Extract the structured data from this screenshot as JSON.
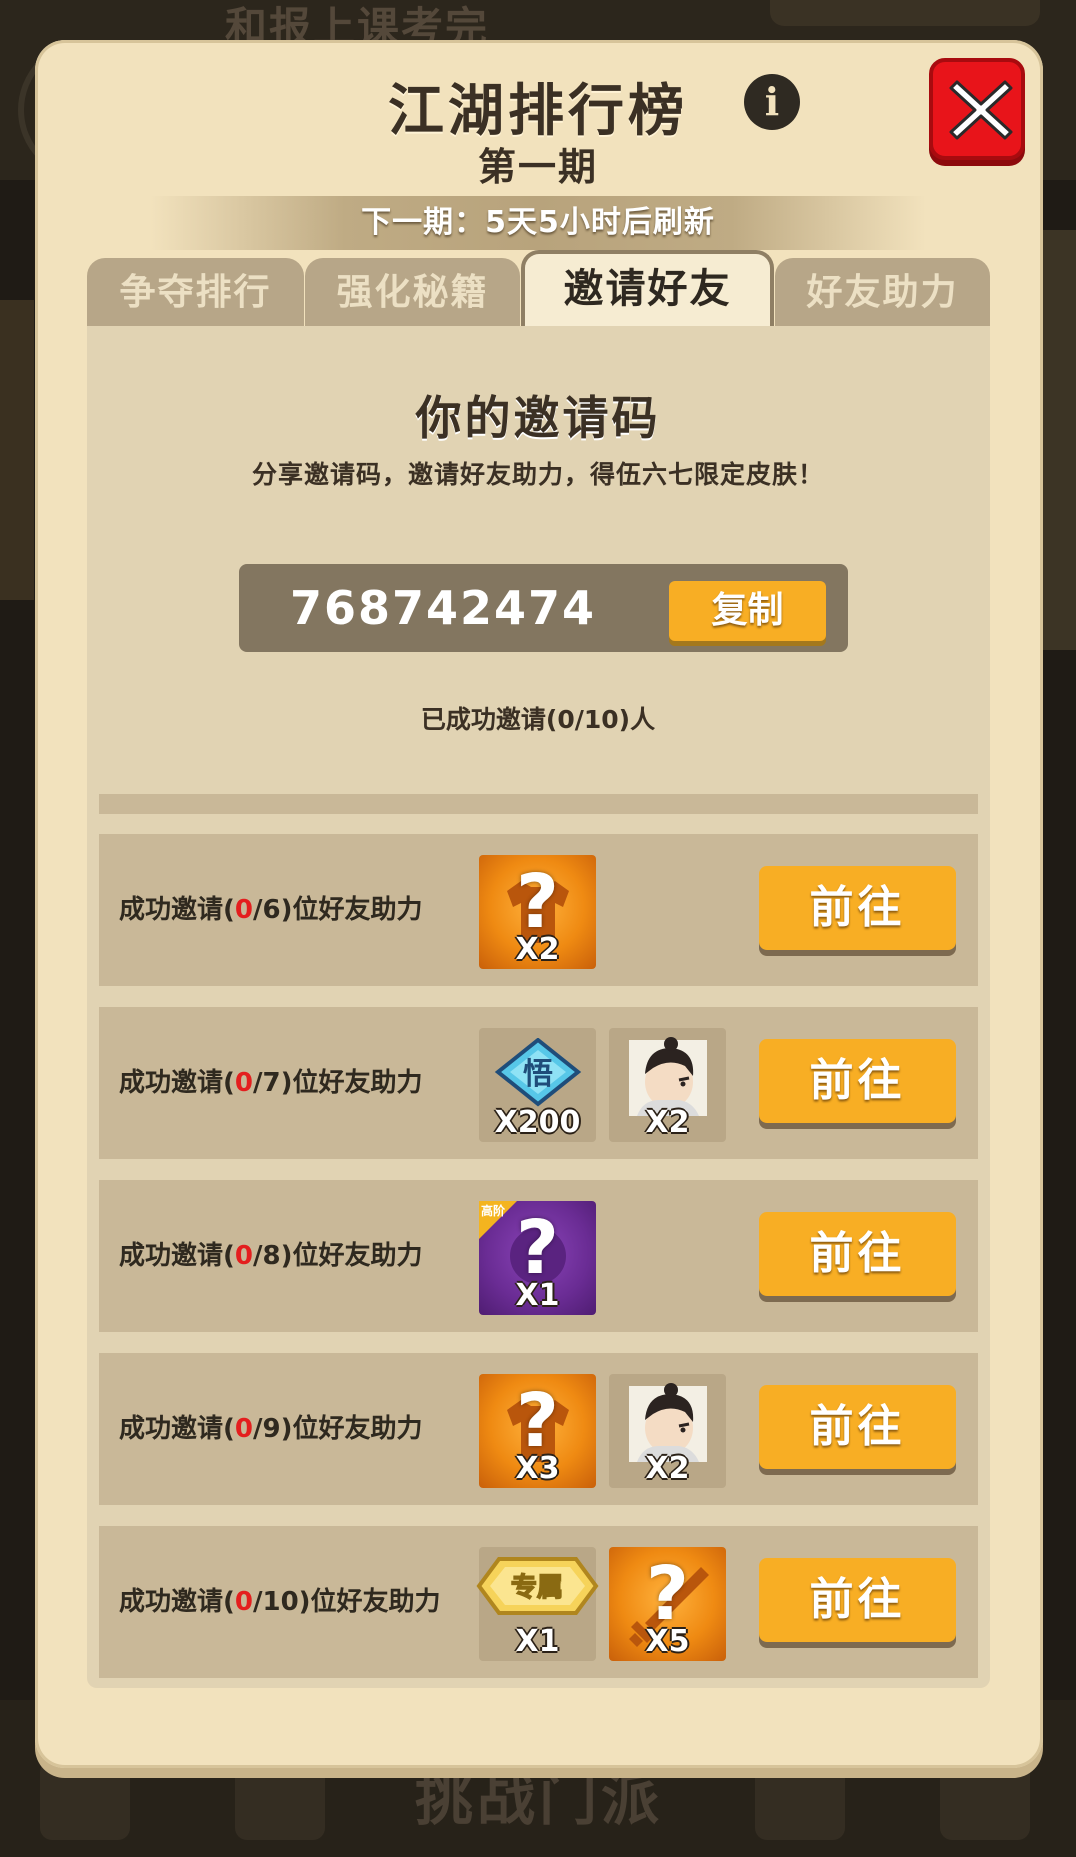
{
  "background": {
    "top_text": "和报上课考完",
    "bottom_text": "挑战门派"
  },
  "panel": {
    "title": "江湖排行榜",
    "subtitle": "第一期",
    "refresh_text": "下一期：5天5小时后刷新",
    "info_icon": "i"
  },
  "tabs": [
    {
      "label": "争夺排行",
      "active": false
    },
    {
      "label": "强化秘籍",
      "active": false
    },
    {
      "label": "邀请好友",
      "active": true
    },
    {
      "label": "好友助力",
      "active": false
    }
  ],
  "invite": {
    "title": "你的邀请码",
    "description": "分享邀请码，邀请好友助力，得伍六七限定皮肤！",
    "code": "768742474",
    "copy_label": "复制",
    "invited_count": "已成功邀请(0/10)人"
  },
  "rows": [
    {
      "label_prefix": "成功邀请(",
      "current": "0",
      "label_suffix": "/6)位好友助力",
      "button": "前往",
      "rewards": [
        {
          "type": "orange-shirt-mystery",
          "qty": "X2",
          "icon": "mystery-shirt-icon"
        }
      ]
    },
    {
      "label_prefix": "成功邀请(",
      "current": "0",
      "label_suffix": "/7)位好友助力",
      "button": "前往",
      "rewards": [
        {
          "type": "diamond",
          "qty": "X200",
          "icon": "wu-diamond-icon",
          "glyph": "悟"
        },
        {
          "type": "character",
          "qty": "X2",
          "icon": "character-portrait-icon"
        }
      ]
    },
    {
      "label_prefix": "成功邀请(",
      "current": "0",
      "label_suffix": "/8)位好友助力",
      "button": "前往",
      "rewards": [
        {
          "type": "purple-mystery",
          "qty": "X1",
          "icon": "advanced-mystery-icon",
          "tag": "高阶"
        }
      ]
    },
    {
      "label_prefix": "成功邀请(",
      "current": "0",
      "label_suffix": "/9)位好友助力",
      "button": "前往",
      "rewards": [
        {
          "type": "orange-shirt-mystery",
          "qty": "X3",
          "icon": "mystery-shirt-icon"
        },
        {
          "type": "character",
          "qty": "X2",
          "icon": "character-portrait-icon"
        }
      ]
    },
    {
      "label_prefix": "成功邀请(",
      "current": "0",
      "label_suffix": "/10)位好友助力",
      "button": "前往",
      "rewards": [
        {
          "type": "exclusive-badge",
          "qty": "X1",
          "icon": "exclusive-badge-icon",
          "glyph": "专属"
        },
        {
          "type": "orange-sword-mystery",
          "qty": "X5",
          "icon": "mystery-sword-icon"
        }
      ]
    }
  ],
  "colors": {
    "panel_bg": "#f2e2bd",
    "accent_button": "#f8ae24",
    "close_red": "#e8141a",
    "progress_red": "#e41e1e"
  }
}
